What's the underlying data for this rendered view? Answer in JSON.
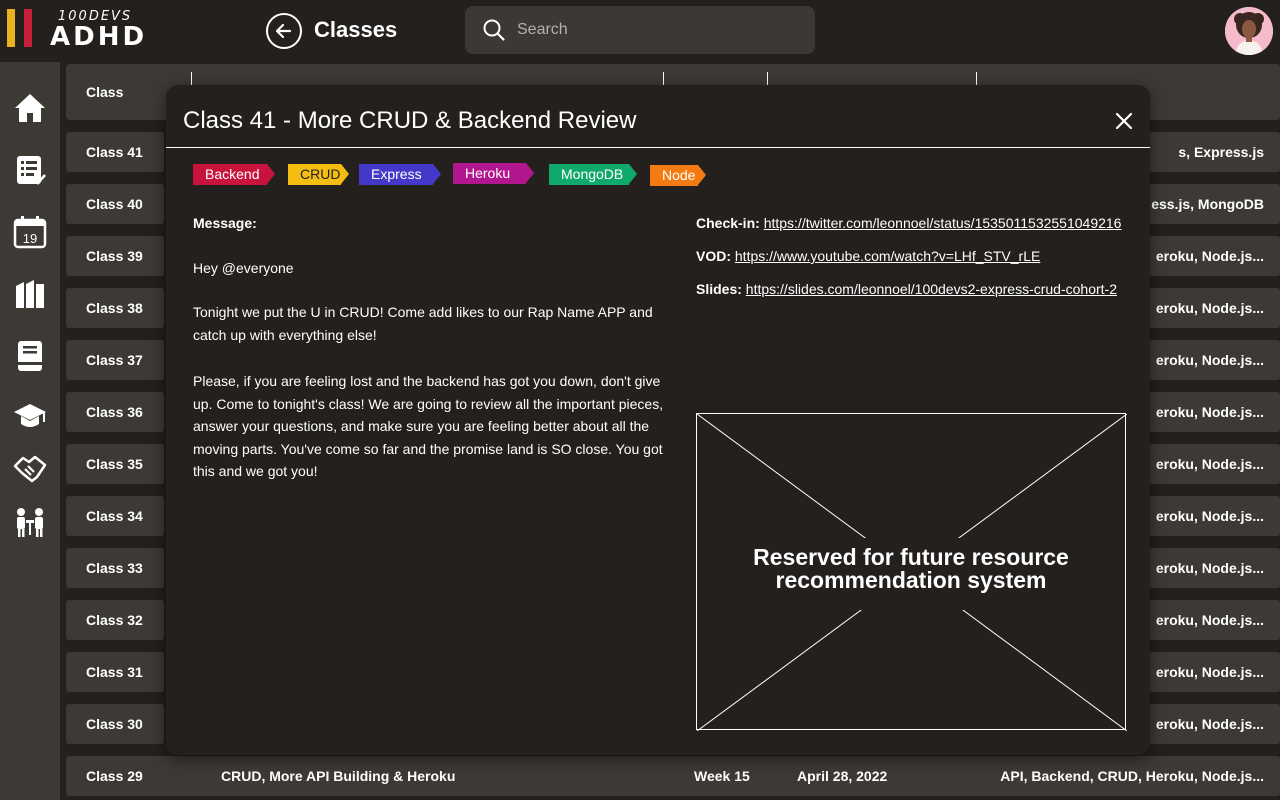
{
  "header": {
    "logo_top": "100DEVS",
    "logo_main": "ADHD",
    "title": "Classes",
    "search_placeholder": "Search"
  },
  "sidebar": {
    "items": [
      "home-icon",
      "checklist-icon",
      "calendar-icon",
      "books-icon",
      "book-icon",
      "graduation-cap-icon",
      "handshake-icon",
      "meeting-icon"
    ],
    "calendar_day": "19"
  },
  "table": {
    "header_first": "Class",
    "rows": [
      {
        "class": "Class 41",
        "tags": "s, Express.js"
      },
      {
        "class": "Class 40",
        "tags": "ess.js, MongoDB"
      },
      {
        "class": "Class 39",
        "tags": "eroku, Node.js..."
      },
      {
        "class": "Class 38",
        "tags": "eroku, Node.js..."
      },
      {
        "class": "Class 37",
        "tags": "eroku, Node.js..."
      },
      {
        "class": "Class 36",
        "tags": "eroku, Node.js..."
      },
      {
        "class": "Class 35",
        "tags": "eroku, Node.js..."
      },
      {
        "class": "Class 34",
        "tags": "eroku, Node.js..."
      },
      {
        "class": "Class 33",
        "tags": "eroku, Node.js..."
      },
      {
        "class": "Class 32",
        "tags": "eroku, Node.js..."
      },
      {
        "class": "Class 31",
        "tags": "eroku, Node.js..."
      },
      {
        "class": "Class 30",
        "tags": "eroku, Node.js..."
      }
    ],
    "last_row": {
      "class": "Class 29",
      "title": "CRUD, More API Building & Heroku",
      "week": "Week 15",
      "date": "April 28, 2022",
      "tags": "API, Backend, CRUD, Heroku, Node.js..."
    }
  },
  "modal": {
    "title": "Class 41 - More CRUD & Backend Review",
    "tags": [
      {
        "label": "Backend",
        "color": "#c8143c"
      },
      {
        "label": "CRUD",
        "color": "#f5bd12"
      },
      {
        "label": "Express",
        "color": "#4338c7"
      },
      {
        "label": "Heroku",
        "color": "#b2168f"
      },
      {
        "label": "MongoDB",
        "color": "#10a86b"
      },
      {
        "label": "Node",
        "color": "#f47a12"
      }
    ],
    "message_label": "Message:",
    "message_paragraphs": [
      "Hey @everyone",
      "Tonight we put the U in CRUD! Come add likes to our Rap Name APP and catch up with everything else!",
      "Please, if you are feeling lost and the backend has got you down, don't give up. Come to tonight's class! We are going to review all the important pieces, answer your questions, and make sure you are feeling better about all the moving parts. You've come so far and the promise land is SO close. You got this and we got you!"
    ],
    "checkin_label": "Check-in:",
    "checkin_url": "https://twitter.com/leonnoel/status/1535011532551049216",
    "vod_label": "VOD:",
    "vod_url": "https://www.youtube.com/watch?v=LHf_STV_rLE",
    "slides_label": "Slides:",
    "slides_url": "https://slides.com/leonnoel/100devs2-express-crud-cohort-2",
    "placeholder_line1": "Reserved for future resource",
    "placeholder_line2": "recommendation system"
  }
}
